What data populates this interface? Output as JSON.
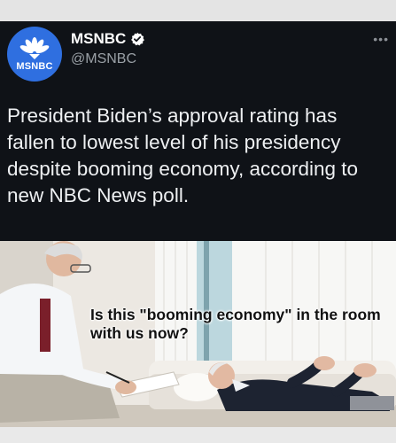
{
  "post": {
    "account_name": "MSNBC",
    "handle": "@MSNBC",
    "avatar_text": "MSNBC",
    "more_icon": "more-options-icon",
    "verified_icon": "verified-badge-icon",
    "text": "President Biden’s approval rating has fallen to lowest level of his presidency despite booming economy, according to new NBC News poll."
  },
  "meme": {
    "caption": "Is this \"booming economy\" in the room with us now?"
  },
  "colors": {
    "tweet_background": "#0f1217",
    "avatar": "#2f6fe0",
    "caption": "#111111"
  }
}
